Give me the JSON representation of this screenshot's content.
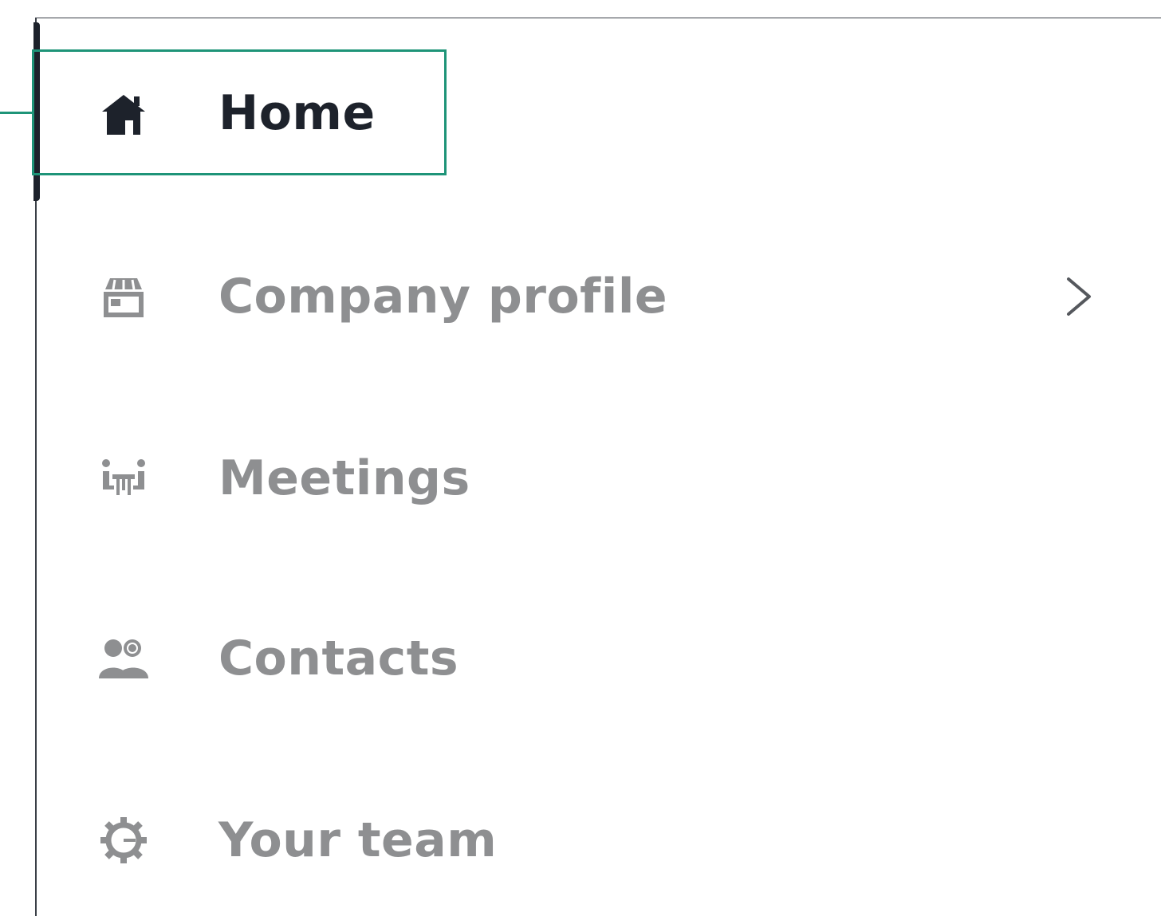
{
  "colors": {
    "active_text": "#1d222b",
    "inactive_text": "#8e8f91",
    "callout_accent": "#1e9478"
  },
  "sidebar": {
    "items": [
      {
        "label": "Home",
        "icon": "home-icon",
        "state": "active"
      },
      {
        "label": "Company profile",
        "icon": "storefront-icon",
        "state": "inactive",
        "has_submenu": true
      },
      {
        "label": "Meetings",
        "icon": "meeting-table-icon",
        "state": "inactive"
      },
      {
        "label": "Contacts",
        "icon": "contacts-icon",
        "state": "inactive"
      },
      {
        "label": "Your team",
        "icon": "gear-icon",
        "state": "inactive"
      }
    ]
  }
}
